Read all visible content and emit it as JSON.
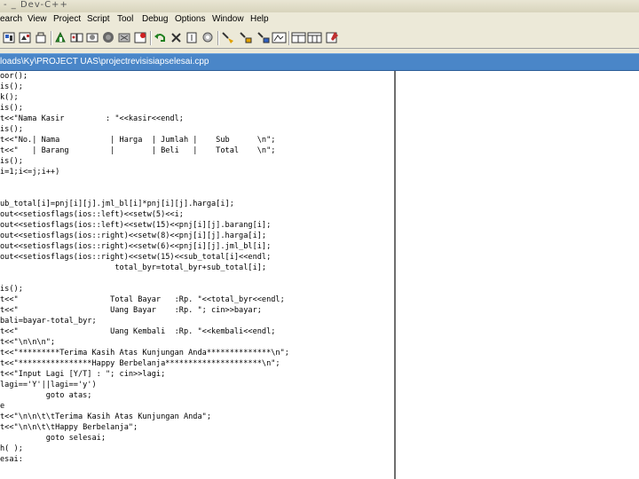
{
  "window": {
    "title": "- _ Dev-C++"
  },
  "menu": {
    "items": [
      "earch",
      "View",
      "Project",
      "Script",
      "Tool",
      "Debug",
      "Options",
      "Window",
      "Help"
    ]
  },
  "toolbar": {
    "buttons": [
      "new-source-icon",
      "compile-icon",
      "run-icon",
      "compile-run-icon",
      "rebuild-icon",
      "debug-icon",
      "add-watch-icon",
      "stop-icon",
      "toggle-breakpoint-icon",
      "undo-icon",
      "delete-icon",
      "insert-icon",
      "settings-icon",
      "step-icon",
      "step-over-icon",
      "step-into-icon",
      "window-icon",
      "class-browser-icon",
      "help-icon"
    ]
  },
  "path": {
    "text": "loads\\Ky\\PROJECT UAS\\projectrevisisiapselesai.cpp"
  },
  "code": {
    "lines": [
      "oor();",
      "is();",
      "k();",
      "is();",
      "t<<\"Nama Kasir         : \"<<kasir<<endl;",
      "is();",
      "t<<\"No.| Nama           | Harga  | Jumlah |    Sub      \\n\";",
      "t<<\"   | Barang         |        | Beli   |    Total    \\n\";",
      "is();",
      "i=1;i<=j;i++)",
      "",
      "",
      "ub_total[i]=pnj[i][j].jml_bl[i]*pnj[i][j].harga[i];",
      "out<<setiosflags(ios::left)<<setw(5)<<i;",
      "out<<setiosflags(ios::left)<<setw(15)<<pnj[i][j].barang[i];",
      "out<<setiosflags(ios::right)<<setw(8)<<pnj[i][j].harga[i];",
      "out<<setiosflags(ios::right)<<setw(6)<<pnj[i][j].jml_bl[i];",
      "out<<setiosflags(ios::right)<<setw(15)<<sub_total[i]<<endl;",
      "                         total_byr=total_byr+sub_total[i];",
      "",
      "is();",
      "t<<\"                    Total Bayar   :Rp. \"<<total_byr<<endl;",
      "t<<\"                    Uang Bayar    :Rp. \"; cin>>bayar;",
      "bali=bayar-total_byr;",
      "t<<\"                    Uang Kembali  :Rp. \"<<kembali<<endl;",
      "t<<\"\\n\\n\\n\";",
      "t<<\"*********Terima Kasih Atas Kunjungan Anda**************\\n\";",
      "t<<\"****************Happy Berbelanja*********************\\n\";",
      "t<<\"Input Lagi [Y/T] : \"; cin>>lagi;",
      "lagi=='Y'||lagi=='y')",
      "          goto atas;",
      "e",
      "t<<\"\\n\\n\\t\\tTerima Kasih Atas Kunjungan Anda\";",
      "t<<\"\\n\\n\\t\\tHappy Berbelanja\";",
      "          goto selesai;",
      "h( );",
      "esai:"
    ]
  }
}
